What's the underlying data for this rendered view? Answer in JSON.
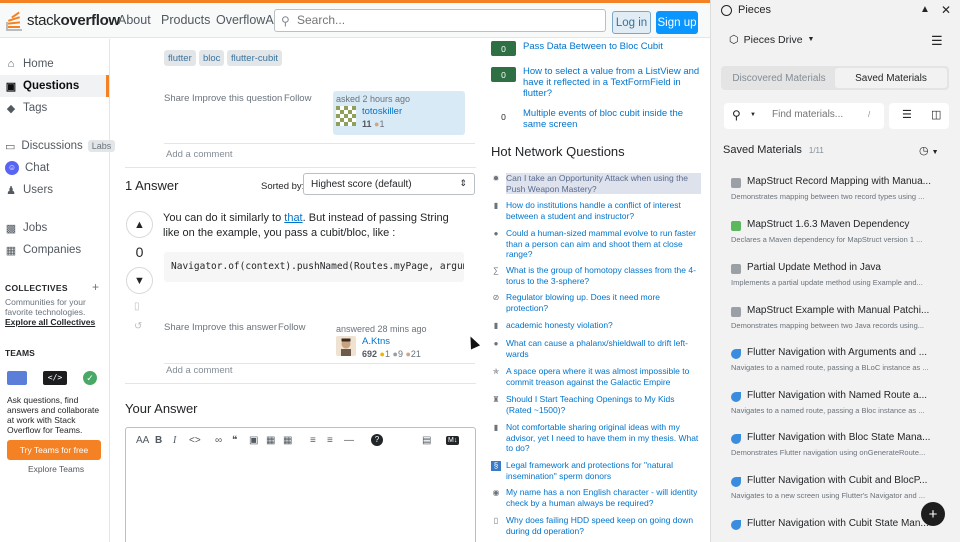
{
  "colors": {
    "accent": "#f48225",
    "link": "#0074cc",
    "primary": "#0a95ff",
    "answered": "#2f6f44"
  },
  "header": {
    "logo_plain": "stack",
    "logo_bold": "overflow",
    "nav": [
      "About",
      "Products",
      "OverflowAI"
    ],
    "search_placeholder": "Search...",
    "login": "Log in",
    "signup": "Sign up"
  },
  "sidebar": {
    "items": [
      {
        "label": "Home",
        "icon": "home-icon"
      },
      {
        "label": "Questions",
        "icon": "questions-icon"
      },
      {
        "label": "Tags",
        "icon": "tag-icon"
      },
      {
        "label": "Discussions",
        "icon": "discussions-icon",
        "badge": "Labs"
      },
      {
        "label": "Chat",
        "icon": "chat-icon"
      },
      {
        "label": "Users",
        "icon": "users-icon"
      },
      {
        "label": "Jobs",
        "icon": "briefcase-icon"
      },
      {
        "label": "Companies",
        "icon": "building-icon"
      }
    ],
    "collectives_title": "COLLECTIVES",
    "collectives_desc": "Communities for your favorite technologies.",
    "collectives_link": "Explore all Collectives",
    "teams_title": "TEAMS",
    "teams_desc": "Ask questions, find answers and collaborate at work with Stack Overflow for Teams.",
    "teams_button": "Try Teams for free",
    "teams_explore": "Explore Teams"
  },
  "question": {
    "tags": [
      "flutter",
      "bloc",
      "flutter-cubit"
    ],
    "actions": [
      "Share",
      "Improve this question",
      "Follow"
    ],
    "asked": "asked 2 hours ago",
    "user": "totoskiller",
    "rep": "11",
    "bronze": "1",
    "add_comment": "Add a comment"
  },
  "answers": {
    "count_label": "1 Answer",
    "sorted_by": "Sorted by:",
    "sort_value": "Highest score (default)",
    "vote_count": "0",
    "text_before": "You can do it similarly to ",
    "link_text": "that",
    "text_after": ". But instead of passing String like on the example, you pass a cubit/bloc, like :",
    "code": "Navigator.of(context).pushNamed(Routes.myPage, arguments",
    "actions": [
      "Share",
      "Improve this answer",
      "Follow"
    ],
    "answered": "answered 28 mins ago",
    "user": "A.Ktns",
    "rep": "692",
    "gold": "1",
    "silver": "9",
    "bronze": "21",
    "add_comment": "Add a comment"
  },
  "your_answer": {
    "title": "Your Answer",
    "md_badge": "M↓"
  },
  "related": [
    {
      "count": "0",
      "answered": true,
      "title": "Pass Data Between to Bloc Cubit"
    },
    {
      "count": "0",
      "answered": true,
      "title": "How to select a value from a ListView and have it reflected in a TextFormField in flutter?"
    },
    {
      "count": "0",
      "answered": false,
      "title": "Multiple events of bloc cubit inside the same screen"
    }
  ],
  "hnq": {
    "title": "Hot Network Questions",
    "items": [
      "Can I take an Opportunity Attack when using the Push Weapon Mastery?",
      "How do institutions handle a conflict of interest between a student and instructor?",
      "Could a human-sized mammal evolve to run faster than a person can aim and shoot them at close range?",
      "What is the group of homotopy classes from the 4-torus to the 3-sphere?",
      "Regulator blowing up. Does it need more protection?",
      "academic honesty violation?",
      "What can cause a phalanx/shieldwall to drift left-wards",
      "A space opera where it was almost impossible to commit treason against the Galactic Empire",
      "Should I Start Teaching Openings to My Kids (Rated ~1500)?",
      "Not comfortable sharing original ideas with my advisor, yet I need to have them in my thesis. What to do?",
      "Legal framework and protections for \"natural insemination\" sperm donors",
      "My name has a non English character - will identity check by a human always be required?",
      "Why does failing HDD speed keep on going down during dd operation?"
    ]
  },
  "pieces": {
    "title": "Pieces",
    "drive": "Pieces Drive",
    "tabs": [
      "Discovered Materials",
      "Saved Materials"
    ],
    "search_placeholder": "Find materials...",
    "slash_hint": "/",
    "saved_title": "Saved Materials",
    "saved_count": "1/11",
    "items": [
      {
        "name": "MapStruct Record Mapping with Manua...",
        "desc": "Demonstrates mapping between two record types using ...",
        "icon_color": "#9aa0a6"
      },
      {
        "name": "MapStruct 1.6.3 Maven Dependency",
        "desc": "Declares a Maven dependency for MapStruct version 1 ...",
        "icon_color": "#5cb85c"
      },
      {
        "name": "Partial Update Method in Java",
        "desc": "Implements a partial update method using Example and...",
        "icon_color": "#9aa0a6"
      },
      {
        "name": "MapStruct Example with Manual Patchi...",
        "desc": "Demonstrates mapping between two Java records using...",
        "icon_color": "#9aa0a6"
      },
      {
        "name": "Flutter Navigation with Arguments and ...",
        "desc": "Navigates to a named route, passing a BLoC instance as ...",
        "icon_color": "#3a8dde"
      },
      {
        "name": "Flutter Navigation with Named Route a...",
        "desc": "Navigates to a named route, passing a Bloc instance as ...",
        "icon_color": "#3a8dde"
      },
      {
        "name": "Flutter Navigation with Bloc State Mana...",
        "desc": "Demonstrates Flutter navigation using onGenerateRoute...",
        "icon_color": "#3a8dde"
      },
      {
        "name": "Flutter Navigation with Cubit and BlocP...",
        "desc": "Navigates to a new screen using Flutter's Navigator and ...",
        "icon_color": "#3a8dde"
      },
      {
        "name": "Flutter Navigation with Cubit State Man...",
        "desc": "",
        "icon_color": "#3a8dde"
      }
    ]
  }
}
